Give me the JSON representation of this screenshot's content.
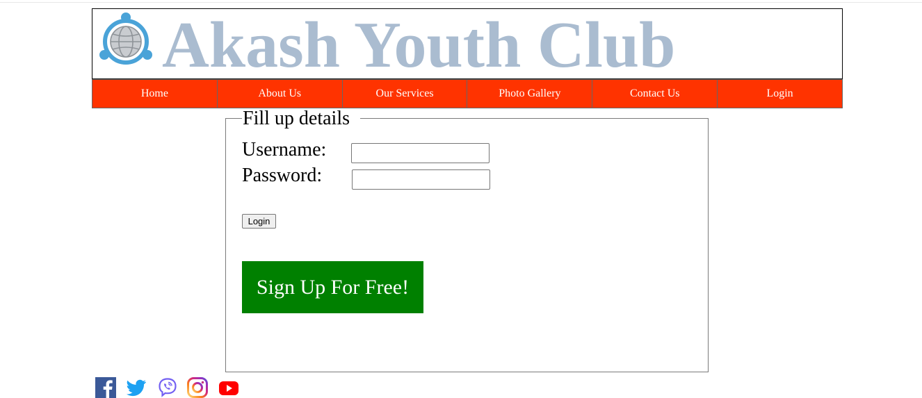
{
  "site": {
    "title": "Akash Youth Club",
    "logo_icon": "globe-people-icon"
  },
  "nav": {
    "items": [
      {
        "label": "Home"
      },
      {
        "label": "About Us"
      },
      {
        "label": "Our Services"
      },
      {
        "label": "Photo Gallery"
      },
      {
        "label": "Contact Us"
      },
      {
        "label": "Login"
      }
    ],
    "color": "#ff3300"
  },
  "form": {
    "legend": "Fill up details",
    "username_label": "Username:",
    "username_value": "",
    "password_label": "Password:",
    "password_value": "",
    "login_button": "Login"
  },
  "signup": {
    "label": "Sign Up For Free!",
    "color": "#008000"
  },
  "social": {
    "icons": [
      "facebook-icon",
      "twitter-icon",
      "viber-icon",
      "instagram-icon",
      "youtube-icon"
    ]
  },
  "colors": {
    "title": "#aabcd0",
    "logo": "#4aa3d8"
  }
}
